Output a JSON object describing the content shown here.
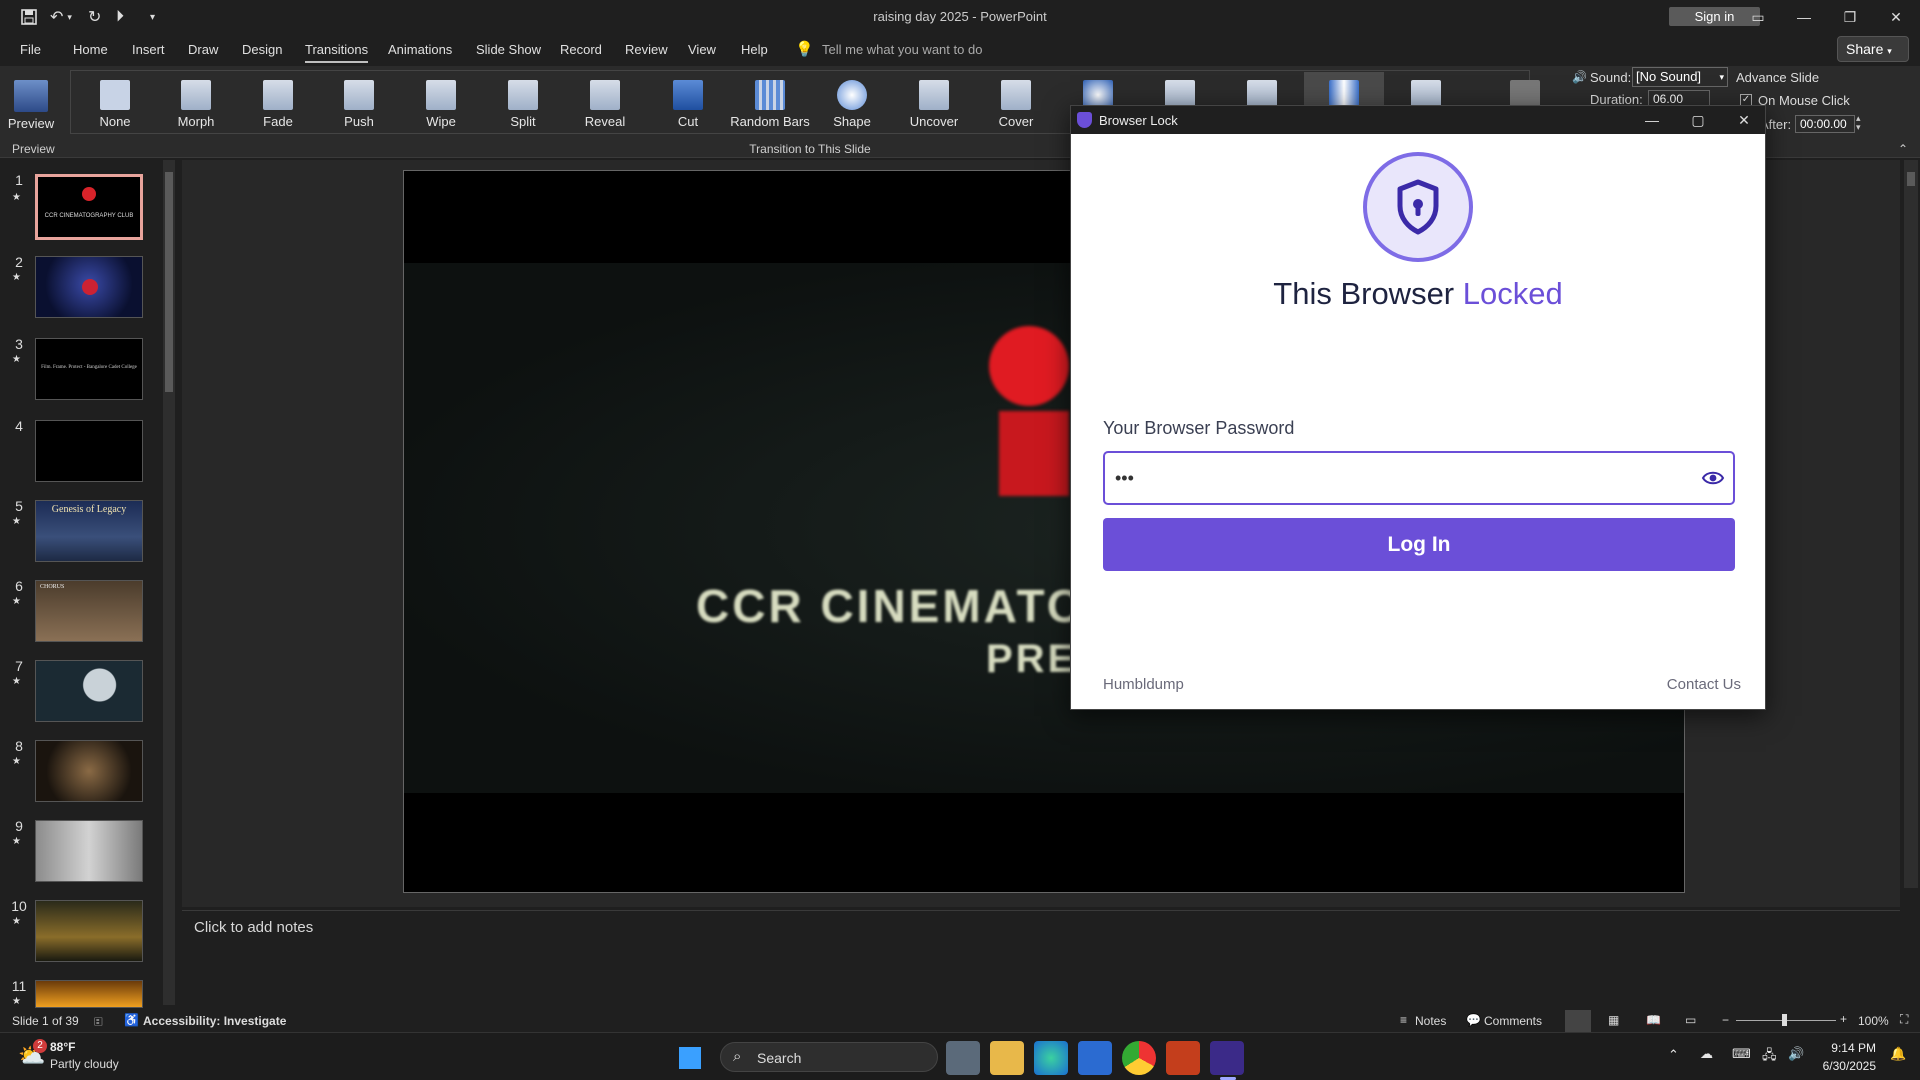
{
  "app": {
    "title": "raising day 2025  -  PowerPoint",
    "sign_in": "Sign in",
    "share": "Share"
  },
  "menu": {
    "tabs": [
      "File",
      "Home",
      "Insert",
      "Draw",
      "Design",
      "Transitions",
      "Animations",
      "Slide Show",
      "Record",
      "Review",
      "View",
      "Help"
    ],
    "active_tab": "Transitions",
    "tell_me": "Tell me what you want to do"
  },
  "ribbon": {
    "preview_label": "Preview",
    "preview_group": "Preview",
    "transitions": [
      "None",
      "Morph",
      "Fade",
      "Push",
      "Wipe",
      "Split",
      "Reveal",
      "Cut",
      "Random Bars",
      "Shape",
      "Uncover",
      "Cover"
    ],
    "transitions_group": "Transition to This Slide",
    "sound_label": "Sound:",
    "sound_value": "[No Sound]",
    "duration_label": "Duration:",
    "duration_value": "06.00",
    "advance_label": "Advance Slide",
    "on_mouse_click": "On Mouse Click",
    "after_label": "After:",
    "after_value": "00:00.00"
  },
  "slides": {
    "numbers": [
      "1",
      "2",
      "3",
      "4",
      "5",
      "6",
      "7",
      "8",
      "9",
      "10",
      "11"
    ],
    "selected": 1,
    "thumb_texts": {
      "s1": "CCR CINEMATOGRAPHY CLUB",
      "s3": "Film. Frame. Protect - Bangalore Cadet College",
      "s5": "Genesis of Legacy",
      "s6": "CHORUS"
    }
  },
  "slide_content": {
    "title": "CCR CINEMATO",
    "subtitle": "PRES"
  },
  "notes": {
    "placeholder": "Click to add notes"
  },
  "status": {
    "slide_info": "Slide 1 of 39",
    "accessibility": "Accessibility: Investigate",
    "notes": "Notes",
    "comments": "Comments",
    "zoom": "100%"
  },
  "dialog": {
    "title": "Browser Lock",
    "heading_main": "This Browser",
    "heading_accent": "Locked",
    "password_label": "Your Browser Password",
    "password_value": "•••",
    "login_button": "Log In",
    "footer_left": "Humbldump",
    "footer_right": "Contact Us",
    "accent_color": "#6b4fd8"
  },
  "taskbar": {
    "weather_temp": "88°F",
    "weather_desc": "Partly cloudy",
    "weather_badge": "2",
    "search": "Search",
    "time": "9:14 PM",
    "date": "6/30/2025"
  }
}
